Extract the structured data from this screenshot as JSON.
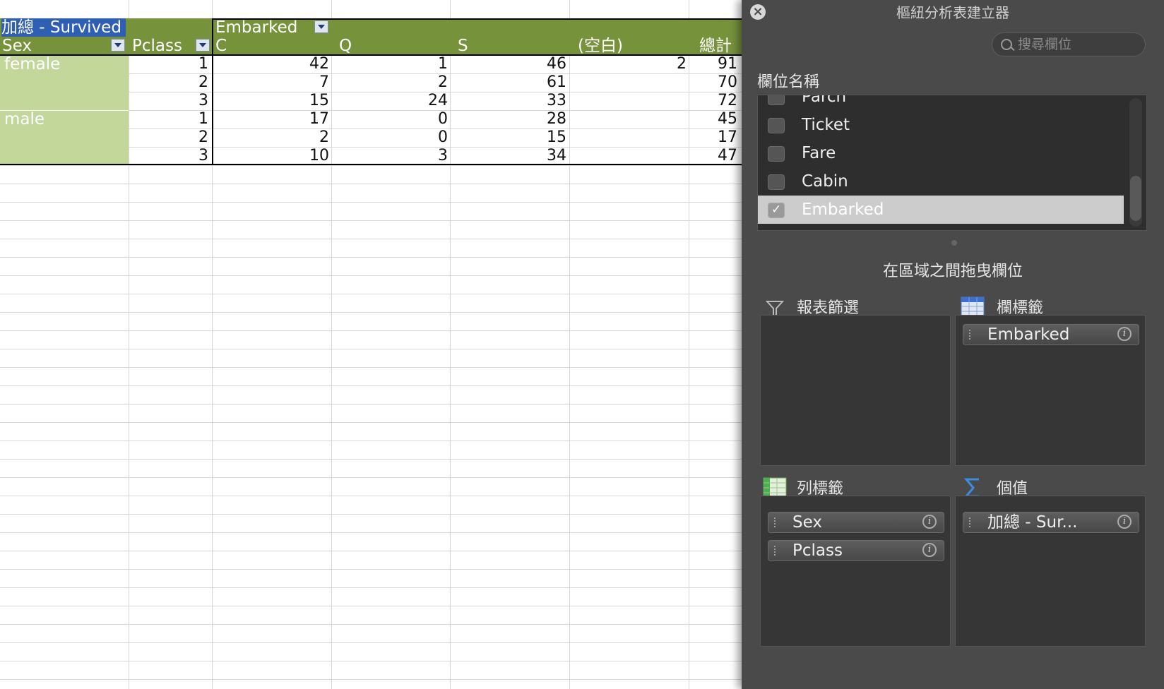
{
  "sheet": {
    "pivot": {
      "value_header": "加總 - Survived",
      "col_field": "Embarked",
      "row_field_1": "Sex",
      "row_field_2": "Pclass",
      "col_headers": [
        "C",
        "Q",
        "S",
        "(空白)",
        "總計"
      ],
      "rows": [
        {
          "sex": "female",
          "pclass": "1",
          "values": [
            "42",
            "1",
            "46",
            "2",
            "91"
          ]
        },
        {
          "sex": "",
          "pclass": "2",
          "values": [
            "7",
            "2",
            "61",
            "",
            "70"
          ]
        },
        {
          "sex": "",
          "pclass": "3",
          "values": [
            "15",
            "24",
            "33",
            "",
            "72"
          ]
        },
        {
          "sex": "male",
          "pclass": "1",
          "values": [
            "17",
            "0",
            "28",
            "",
            "45"
          ]
        },
        {
          "sex": "",
          "pclass": "2",
          "values": [
            "2",
            "0",
            "15",
            "",
            "17"
          ]
        },
        {
          "sex": "",
          "pclass": "3",
          "values": [
            "10",
            "3",
            "34",
            "",
            "47"
          ]
        }
      ]
    }
  },
  "panel": {
    "title": "樞紐分析表建立器",
    "close_icon": "close-icon",
    "search_placeholder": "搜尋欄位",
    "field_names_label": "欄位名稱",
    "fields": [
      {
        "label": "Parch",
        "checked": false
      },
      {
        "label": "Ticket",
        "checked": false
      },
      {
        "label": "Fare",
        "checked": false
      },
      {
        "label": "Cabin",
        "checked": false
      },
      {
        "label": "Embarked",
        "checked": true
      }
    ],
    "drag_hint": "在區域之間拖曳欄位",
    "zones": {
      "report_filter": {
        "label": "報表篩選",
        "icon": "filter-icon",
        "items": []
      },
      "column_labels": {
        "label": "欄標籤",
        "icon": "column-labels-icon",
        "items": [
          "Embarked"
        ]
      },
      "row_labels": {
        "label": "列標籤",
        "icon": "row-labels-icon",
        "items": [
          "Sex",
          "Pclass"
        ]
      },
      "values": {
        "label": "個值",
        "icon": "sigma-icon",
        "items": [
          "加總 - Sur..."
        ]
      }
    }
  },
  "colors": {
    "header_green": "#76933c",
    "row_green": "#c4d79b",
    "panel_bg": "#4a4a4a"
  }
}
